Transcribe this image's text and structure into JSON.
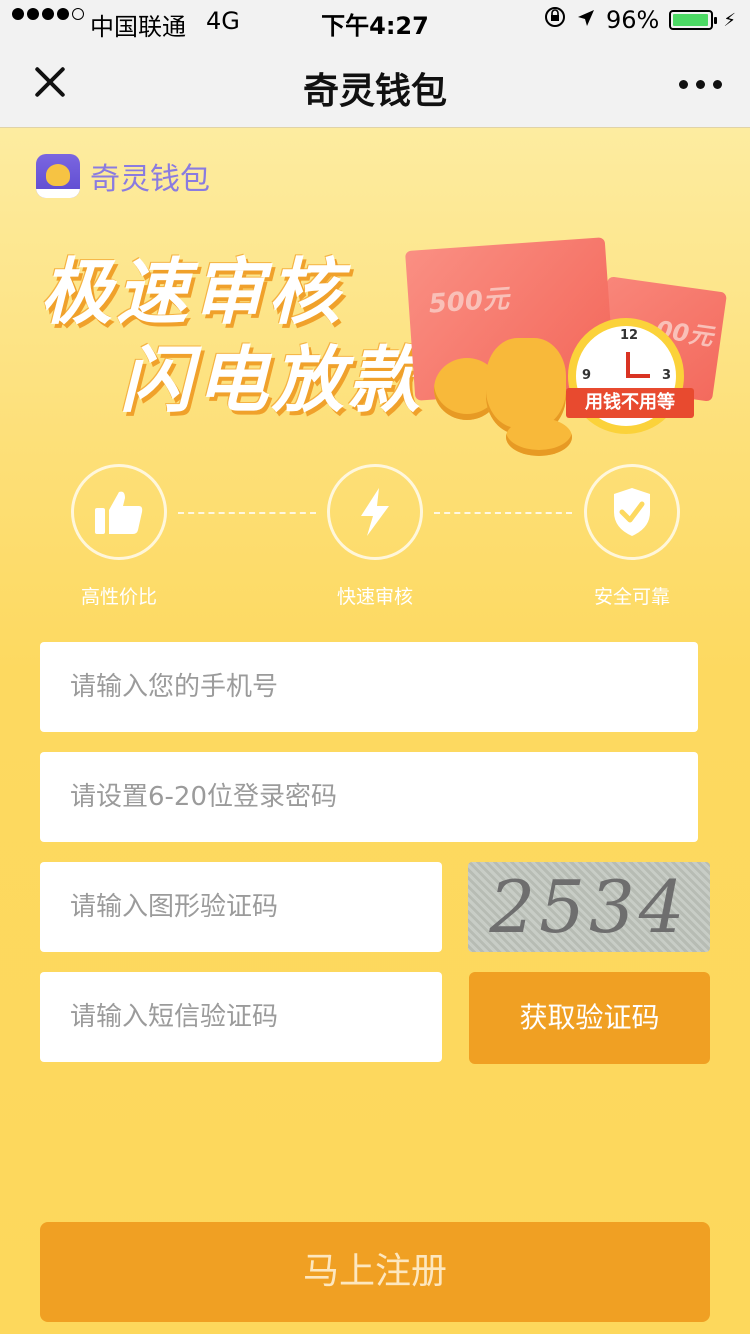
{
  "status_bar": {
    "carrier": "中国联通",
    "network": "4G",
    "time": "下午4:27",
    "battery": "96%",
    "battery_level": 0.96
  },
  "nav": {
    "title": "奇灵钱包",
    "left_icon": "close-icon",
    "right_icon": "more-icon"
  },
  "brand": {
    "name": "奇灵钱包"
  },
  "hero": {
    "line1": "极速审核",
    "line2": "闪电放款",
    "card_front_text": "500元",
    "card_back_text": "00元",
    "ribbon_text": "用钱不用等",
    "clock_12": "12",
    "clock_3": "3",
    "clock_9": "9"
  },
  "features": [
    {
      "label": "高性价比",
      "icon": "thumbs-up-icon"
    },
    {
      "label": "快速审核",
      "icon": "lightning-icon"
    },
    {
      "label": "安全可靠",
      "icon": "shield-check-icon"
    }
  ],
  "form": {
    "phone_placeholder": "请输入您的手机号",
    "password_placeholder": "请设置6-20位登录密码",
    "image_code_placeholder": "请输入图形验证码",
    "sms_code_placeholder": "请输入短信验证码",
    "captcha_text": "2534",
    "get_code_label": "获取验证码",
    "register_label": "马上注册"
  },
  "colors": {
    "background": "#fdd75d",
    "accent_button": "#f0a023",
    "brand_text": "#8a7be0"
  }
}
